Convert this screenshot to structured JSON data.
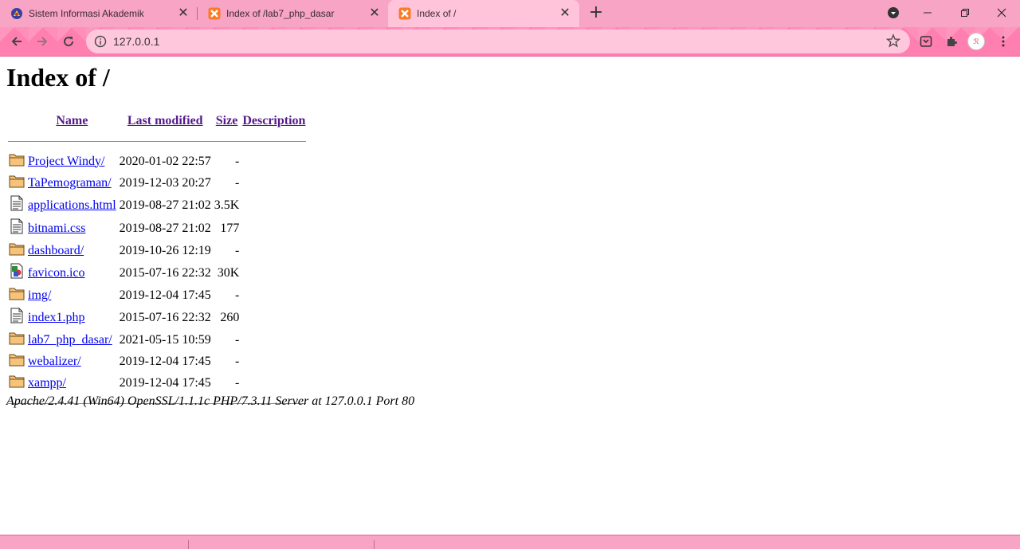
{
  "browser": {
    "tabs": [
      {
        "title": "Sistem Informasi Akademik",
        "active": false
      },
      {
        "title": "Index of /lab7_php_dasar",
        "active": false
      },
      {
        "title": "Index of /",
        "active": true
      }
    ],
    "address": "127.0.0.1"
  },
  "page": {
    "heading": "Index of /",
    "columns": {
      "name": "Name",
      "modified": "Last modified",
      "size": "Size",
      "description": "Description"
    },
    "rows": [
      {
        "icon": "folder-icon",
        "name": "Project Windy/",
        "modified": "2020-01-02 22:57",
        "size": "-"
      },
      {
        "icon": "folder-icon",
        "name": "TaPemograman/",
        "modified": "2019-12-03 20:27",
        "size": "-"
      },
      {
        "icon": "text-file-icon",
        "name": "applications.html",
        "modified": "2019-08-27 21:02",
        "size": "3.5K"
      },
      {
        "icon": "text-file-icon",
        "name": "bitnami.css",
        "modified": "2019-08-27 21:02",
        "size": "177"
      },
      {
        "icon": "folder-icon",
        "name": "dashboard/",
        "modified": "2019-10-26 12:19",
        "size": "-"
      },
      {
        "icon": "image-file-icon",
        "name": "favicon.ico",
        "modified": "2015-07-16 22:32",
        "size": "30K"
      },
      {
        "icon": "folder-icon",
        "name": "img/",
        "modified": "2019-12-04 17:45",
        "size": "-"
      },
      {
        "icon": "text-file-icon",
        "name": "index1.php",
        "modified": "2015-07-16 22:32",
        "size": "260"
      },
      {
        "icon": "folder-icon",
        "name": "lab7_php_dasar/",
        "modified": "2021-05-15 10:59",
        "size": "-"
      },
      {
        "icon": "folder-icon",
        "name": "webalizer/",
        "modified": "2019-12-04 17:45",
        "size": "-"
      },
      {
        "icon": "folder-icon",
        "name": "xampp/",
        "modified": "2019-12-04 17:45",
        "size": "-"
      }
    ],
    "footer": "Apache/2.4.41 (Win64) OpenSSL/1.1.1c PHP/7.3.11 Server at 127.0.0.1 Port 80"
  }
}
